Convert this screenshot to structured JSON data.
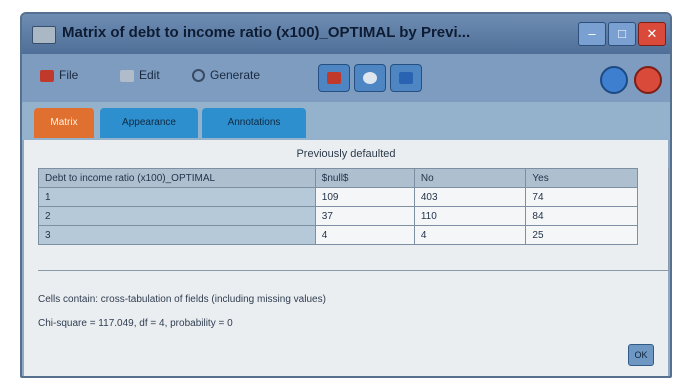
{
  "window": {
    "title": "Matrix of debt to income ratio (x100)_OPTIMAL by Previ...",
    "controls": {
      "minimize": "–",
      "maximize": "□",
      "close": "✕"
    }
  },
  "toolbar": {
    "file_label": "File",
    "edit_label": "Edit",
    "generate_label": "Generate",
    "icons": [
      "print-icon",
      "export-icon",
      "chart-icon",
      "help-icon",
      "close-icon"
    ]
  },
  "tabs": [
    {
      "label": "Matrix",
      "active": true
    },
    {
      "label": "Appearance",
      "active": false
    },
    {
      "label": "Annotations",
      "active": false
    }
  ],
  "matrix": {
    "column_group_label": "Previously defaulted",
    "columns": [
      "Debt to income ratio (x100)_OPTIMAL",
      "$null$",
      "No",
      "Yes"
    ],
    "rows": [
      {
        "label": "1",
        "values": [
          "109",
          "403",
          "74"
        ]
      },
      {
        "label": "2",
        "values": [
          "37",
          "110",
          "84"
        ]
      },
      {
        "label": "3",
        "values": [
          "4",
          "4",
          "25"
        ]
      }
    ]
  },
  "notes": {
    "cells_contain": "Cells contain: cross-tabulation of fields (including missing values)",
    "chi_square": "Chi-square = 117.049, df = 4, probability = 0"
  },
  "ok_label": "OK",
  "colors": {
    "titlebar": "#5a7aa3",
    "active_tab": "#e0702f",
    "inactive_tab": "#2d8fcd",
    "close_button": "#d94a3b"
  }
}
